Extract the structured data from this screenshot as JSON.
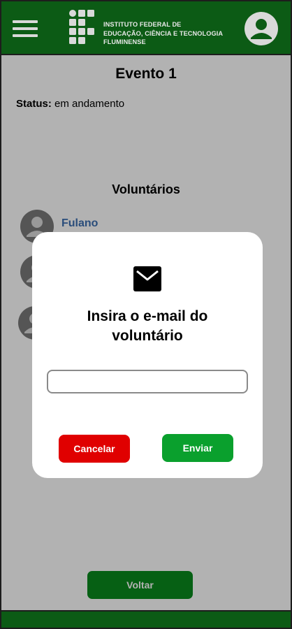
{
  "header": {
    "menu_icon": "hamburger-menu-icon",
    "logo_icon": "ifff-logo-icon",
    "institution_lines": [
      "INSTITUTO FEDERAL DE",
      "EDUCAÇÃO, CIÊNCIA E TECNOLOGIA",
      "FLUMINENSE"
    ],
    "profile_icon": "user-account-icon"
  },
  "event": {
    "title": "Evento 1",
    "status_label": "Status:",
    "status_value": "em andamento"
  },
  "volunteers": {
    "section_title": "Voluntários",
    "items": [
      {
        "name": "Fulano",
        "avatar_icon": "user-avatar-icon"
      },
      {
        "name": "",
        "avatar_icon": "user-avatar-icon"
      },
      {
        "name": "",
        "avatar_icon": "user-avatar-icon"
      }
    ]
  },
  "actions": {
    "back_label": "Voltar"
  },
  "modal": {
    "icon": "mail-icon",
    "title_line1": "Insira o e-mail do",
    "title_line2": "voluntário",
    "email_value": "",
    "email_placeholder": "",
    "cancel_label": "Cancelar",
    "send_label": "Enviar"
  },
  "colors": {
    "header_green": "#0c5b15",
    "back_button": "#0a8a1e",
    "send_button": "#0aa02d",
    "cancel_button": "#e00000",
    "link_blue": "#3d6fb0"
  }
}
